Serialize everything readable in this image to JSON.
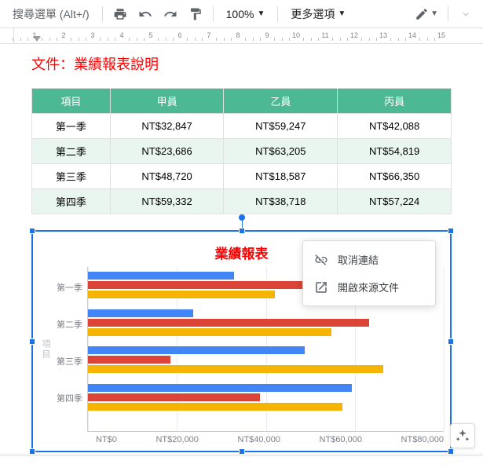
{
  "toolbar": {
    "search_placeholder": "搜尋選單 (Alt+/)",
    "zoom": "100%",
    "more_options": "更多選項"
  },
  "ruler_marks": [
    1,
    2,
    3,
    4,
    5,
    6,
    7,
    8,
    9,
    10,
    11,
    12,
    13,
    14,
    15
  ],
  "doc": {
    "title": "文件：業績報表說明"
  },
  "table": {
    "headers": [
      "項目",
      "甲員",
      "乙員",
      "丙員"
    ],
    "rows": [
      [
        "第一季",
        "NT$32,847",
        "NT$59,247",
        "NT$42,088"
      ],
      [
        "第二季",
        "NT$23,686",
        "NT$63,205",
        "NT$54,819"
      ],
      [
        "第三季",
        "NT$48,720",
        "NT$18,587",
        "NT$66,350"
      ],
      [
        "第四季",
        "NT$59,332",
        "NT$38,718",
        "NT$57,224"
      ]
    ]
  },
  "chart_data": {
    "type": "bar",
    "orientation": "horizontal",
    "title": "業績報表",
    "ylabel": "項目",
    "categories": [
      "第一季",
      "第二季",
      "第三季",
      "第四季"
    ],
    "series": [
      {
        "name": "甲員",
        "color": "#4285f4",
        "values": [
          32847,
          23686,
          48720,
          59332
        ]
      },
      {
        "name": "乙員",
        "color": "#db4437",
        "values": [
          59247,
          63205,
          18587,
          38718
        ]
      },
      {
        "name": "丙員",
        "color": "#f4b400",
        "values": [
          42088,
          54819,
          66350,
          57224
        ]
      }
    ],
    "xlim": [
      0,
      80000
    ],
    "xticks": [
      "NT$0",
      "NT$20,000",
      "NT$40,000",
      "NT$60,000",
      "NT$80,000"
    ]
  },
  "context_menu": {
    "unlink": "取消連結",
    "open_source": "開啟來源文件"
  }
}
